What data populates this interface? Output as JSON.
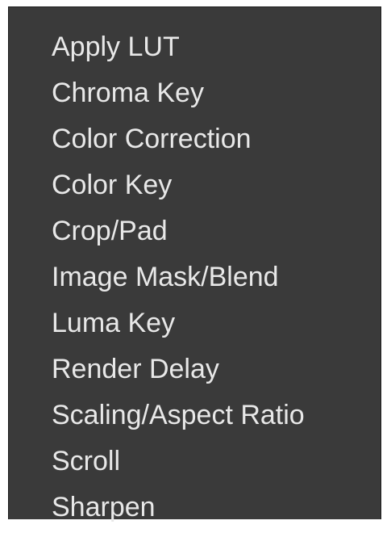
{
  "menu": {
    "items": [
      {
        "label": "Apply LUT"
      },
      {
        "label": "Chroma Key"
      },
      {
        "label": "Color Correction"
      },
      {
        "label": "Color Key"
      },
      {
        "label": "Crop/Pad"
      },
      {
        "label": "Image Mask/Blend"
      },
      {
        "label": "Luma Key"
      },
      {
        "label": "Render Delay"
      },
      {
        "label": "Scaling/Aspect Ratio"
      },
      {
        "label": "Scroll"
      },
      {
        "label": "Sharpen"
      }
    ]
  },
  "colors": {
    "background": "#3a3a3a",
    "text": "#e8e8e8"
  }
}
